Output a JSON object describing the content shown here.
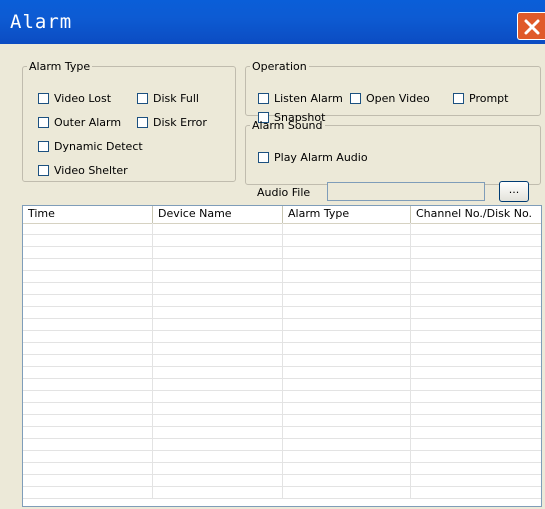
{
  "window": {
    "title": "Alarm",
    "close_icon": "close-icon",
    "close_color": "#e05a2a",
    "titlebar_color": "#0b57d0"
  },
  "alarm_type": {
    "legend": "Alarm Type",
    "items": [
      {
        "label": "Video Lost",
        "checked": false
      },
      {
        "label": "Disk Full",
        "checked": false
      },
      {
        "label": "Outer Alarm",
        "checked": false
      },
      {
        "label": "Disk Error",
        "checked": false
      },
      {
        "label": "Dynamic Detect",
        "checked": false
      },
      {
        "label": "Video Shelter",
        "checked": false
      }
    ]
  },
  "operation": {
    "legend": "Operation",
    "items": [
      {
        "label": "Listen Alarm",
        "checked": false
      },
      {
        "label": "Open Video",
        "checked": false
      },
      {
        "label": "Prompt",
        "checked": false
      },
      {
        "label": "Snapshot",
        "checked": false
      }
    ]
  },
  "alarm_sound": {
    "legend": "Alarm Sound",
    "play_label": "Play Alarm Audio",
    "play_checked": false,
    "audio_file_label": "Audio File",
    "audio_file_value": "",
    "browse_label": "..."
  },
  "table": {
    "columns": [
      "Time",
      "Device Name",
      "Alarm Type",
      "Channel No./Disk No."
    ],
    "rows": []
  }
}
